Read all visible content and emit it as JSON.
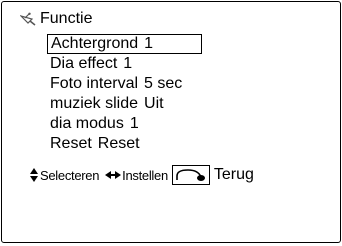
{
  "header": {
    "title": "Functie",
    "icon": "satellite-dish-icon"
  },
  "menu": {
    "items": [
      {
        "label": "Achtergrond",
        "value": "1"
      },
      {
        "label": "Dia effect",
        "value": "1"
      },
      {
        "label": "Foto interval",
        "value": "5 sec"
      },
      {
        "label": "muziek slide",
        "value": "Uit"
      },
      {
        "label": "dia modus",
        "value": "1"
      },
      {
        "label": "Reset",
        "value": "Reset"
      }
    ],
    "selected_index": 0
  },
  "footer": {
    "select_label": "Selecteren",
    "select_icon": "up-down-arrows-icon",
    "adjust_label": "Instellen",
    "adjust_icon": "left-right-arrows-icon",
    "back_label": "Terug",
    "back_icon": "return-key-icon"
  }
}
